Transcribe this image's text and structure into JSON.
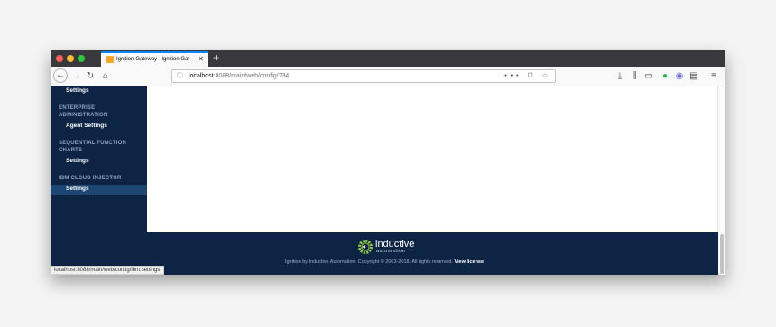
{
  "browser": {
    "tab_title": "Ignition-Gateway - Ignition Gat",
    "new_tab_symbol": "+",
    "close_symbol": "✕",
    "url_host": "localhost",
    "url_path": ":8088/main/web/config/?34",
    "url_actions": "••• ☐ ☆",
    "status_url": "localhost:8088/main/web/config/ibm.settings"
  },
  "sidebar": {
    "items": [
      {
        "type": "item",
        "label": "Settings"
      },
      {
        "type": "header",
        "label": "ENTERPRISE ADMINISTRATION"
      },
      {
        "type": "item",
        "label": "Agent Settings"
      },
      {
        "type": "header",
        "label": "SEQUENTIAL FUNCTION CHARTS"
      },
      {
        "type": "item",
        "label": "Settings"
      },
      {
        "type": "header",
        "label": "IBM CLOUD INJECTOR"
      },
      {
        "type": "item",
        "label": "Settings",
        "selected": true
      }
    ]
  },
  "footer": {
    "logo_text": "inductive",
    "logo_sub": "automation",
    "copyright": "Ignition by Inductive Automation. Copyright © 2003-2018. All rights reserved.",
    "license_link": "View license"
  },
  "colors": {
    "sidebar_bg": "#0e2444",
    "selected_bg": "#1d4673",
    "tab_accent": "#0a84ff",
    "logo_green": "#8dc63f"
  }
}
